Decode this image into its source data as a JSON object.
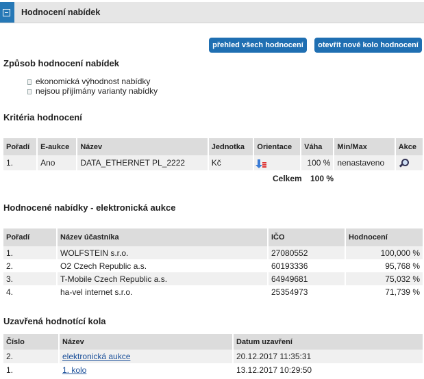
{
  "header": {
    "title": "Hodnocení nabídek"
  },
  "buttons": {
    "overview": "přehled všech hodnocení",
    "new_round": "otevřít nové kolo hodnocení"
  },
  "method": {
    "title": "Způsob hodnocení nabídek",
    "items": [
      "ekonomická výhodnost nabídky",
      "nejsou přijímány varianty nabídky"
    ]
  },
  "criteria": {
    "title": "Kritéria hodnocení",
    "columns": [
      "Pořadí",
      "E-aukce",
      "Název",
      "Jednotka",
      "Orientace",
      "Váha",
      "Min/Max",
      "Akce"
    ],
    "rows": [
      {
        "order": "1.",
        "eauction": "Ano",
        "name": "DATA_ETHERNET PL_2222",
        "unit": "Kč",
        "orientation_icon": "sort-descending-icon",
        "weight": "100 %",
        "minmax": "nenastaveno",
        "action_icon": "magnifier-icon"
      }
    ],
    "total_label": "Celkem",
    "total_value": "100 %"
  },
  "offers": {
    "title": "Hodnocené nabídky - elektronická aukce",
    "columns": [
      "Pořadí",
      "Název účastníka",
      "IČO",
      "Hodnocení"
    ],
    "rows": [
      {
        "order": "1.",
        "name": "WOLFSTEIN s.r.o.",
        "ico": "27080552",
        "score": "100,000 %"
      },
      {
        "order": "2.",
        "name": "O2 Czech Republic a.s.",
        "ico": "60193336",
        "score": "95,768 %"
      },
      {
        "order": "3.",
        "name": "T-Mobile Czech Republic a.s.",
        "ico": "64949681",
        "score": "75,032 %"
      },
      {
        "order": "4.",
        "name": "ha-vel internet s.r.o.",
        "ico": "25354973",
        "score": "71,739 %"
      }
    ]
  },
  "rounds": {
    "title": "Uzavřená hodnotící kola",
    "columns": [
      "Číslo",
      "Název",
      "Datum uzavření"
    ],
    "rows": [
      {
        "number": "2.",
        "name": "elektronická aukce",
        "date": "20.12.2017 11:35:31"
      },
      {
        "number": "1.",
        "name": "1. kolo",
        "date": "13.12.2017 10:29:50"
      }
    ]
  },
  "colors": {
    "accent": "#1f6fb2",
    "header_bg": "#e6e6e6",
    "table_header_bg": "#dcdcdc",
    "row_alt_bg": "#f0f0f0",
    "link": "#1a4f99"
  }
}
